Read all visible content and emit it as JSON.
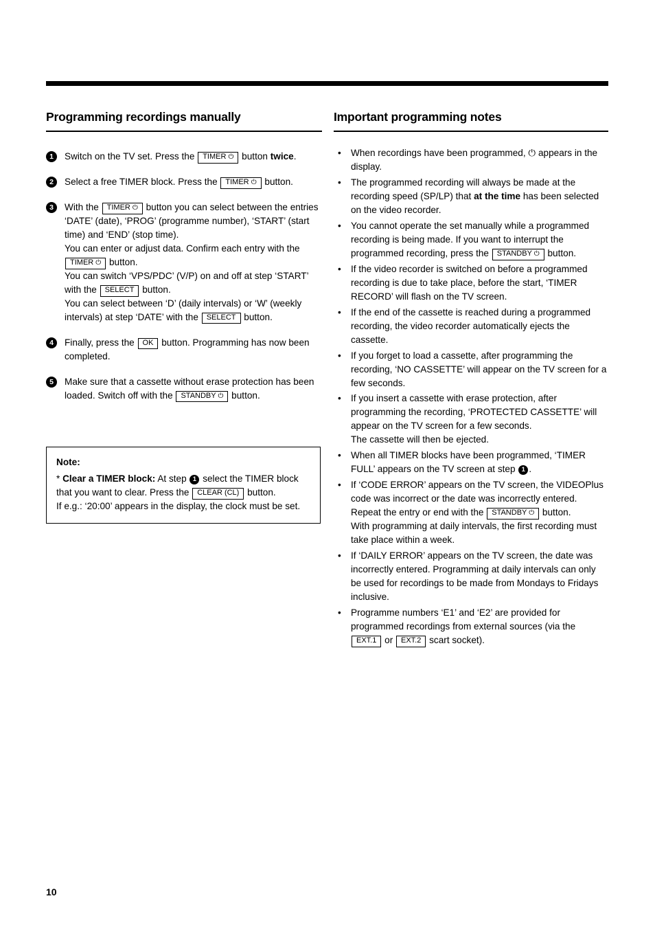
{
  "page_number": "10",
  "left_column": {
    "heading": "Programming recordings manually",
    "steps": [
      {
        "num": "1",
        "parts": [
          {
            "t": "text",
            "v": "Switch on the TV set. Press the "
          },
          {
            "t": "key",
            "v": "TIMER ⏻"
          },
          {
            "t": "text",
            "v": " button "
          },
          {
            "t": "bold",
            "v": "twice"
          },
          {
            "t": "text",
            "v": "."
          }
        ]
      },
      {
        "num": "2",
        "parts": [
          {
            "t": "text",
            "v": "Select a free TIMER block. Press the "
          },
          {
            "t": "key",
            "v": "TIMER ⏻"
          },
          {
            "t": "text",
            "v": " button."
          }
        ]
      },
      {
        "num": "3",
        "parts": [
          {
            "t": "text",
            "v": "With the "
          },
          {
            "t": "key",
            "v": "TIMER ⏻"
          },
          {
            "t": "text",
            "v": " button you can select between the entries ‘DATE’ (date), ‘PROG’ (programme number), ‘START’ (start time) and ‘END’ (stop time)."
          },
          {
            "t": "br"
          },
          {
            "t": "text",
            "v": "You can enter or adjust data. Confirm each entry with the "
          },
          {
            "t": "key",
            "v": "TIMER ⏻"
          },
          {
            "t": "text",
            "v": " button."
          },
          {
            "t": "br"
          },
          {
            "t": "text",
            "v": "You can switch ‘VPS/PDC’ (V/P) on and off at step ‘START’ with the "
          },
          {
            "t": "key",
            "v": "SELECT"
          },
          {
            "t": "text",
            "v": " button."
          },
          {
            "t": "br"
          },
          {
            "t": "text",
            "v": "You can select between ‘D’ (daily intervals) or ‘W’ (weekly intervals) at step ‘DATE’ with the "
          },
          {
            "t": "key",
            "v": "SELECT"
          },
          {
            "t": "text",
            "v": " button."
          }
        ]
      },
      {
        "num": "4",
        "parts": [
          {
            "t": "text",
            "v": "Finally, press the "
          },
          {
            "t": "key",
            "v": "OK"
          },
          {
            "t": "text",
            "v": " button. Programming has now been completed."
          }
        ]
      },
      {
        "num": "5",
        "parts": [
          {
            "t": "text",
            "v": "Make sure that a cassette without erase protection has been loaded. Switch off with the "
          },
          {
            "t": "key",
            "v": "STANDBY ⏻"
          },
          {
            "t": "text",
            "v": " button."
          }
        ]
      }
    ],
    "note": {
      "title": "Note:",
      "parts": [
        {
          "t": "text",
          "v": "* "
        },
        {
          "t": "bold",
          "v": "Clear a TIMER block:"
        },
        {
          "t": "text",
          "v": " At step "
        },
        {
          "t": "circlenum",
          "v": "1"
        },
        {
          "t": "text",
          "v": " select the TIMER block that you want to clear. Press the "
        },
        {
          "t": "key",
          "v": "CLEAR (CL)"
        },
        {
          "t": "text",
          "v": " button."
        },
        {
          "t": "br"
        },
        {
          "t": "text",
          "v": "If e.g.: ‘20:00’ appears in the display, the clock must be set."
        }
      ]
    }
  },
  "right_column": {
    "heading": "Important programming notes",
    "bullets": [
      [
        {
          "t": "text",
          "v": "When recordings have been programmed,  ⏻ appears in the display."
        }
      ],
      [
        {
          "t": "text",
          "v": "The programmed recording will always be made at the recording speed (SP/LP) that "
        },
        {
          "t": "bold",
          "v": "at the time"
        },
        {
          "t": "text",
          "v": " has been selected on the video recorder."
        }
      ],
      [
        {
          "t": "text",
          "v": "You cannot operate the set manually while a programmed recording is being made. If you want to interrupt the programmed recording, press the "
        },
        {
          "t": "key",
          "v": "STANDBY ⏻"
        },
        {
          "t": "text",
          "v": " button."
        }
      ],
      [
        {
          "t": "text",
          "v": "If the video recorder is switched on before a programmed recording is due to take place, before the start, ‘TIMER RECORD’ will flash on the TV screen."
        }
      ],
      [
        {
          "t": "text",
          "v": "If the end of the cassette is reached during a programmed recording, the video recorder automatically ejects the cassette."
        }
      ],
      [
        {
          "t": "text",
          "v": "If you forget to load a cassette, after programming the recording, ‘NO CASSETTE’ will appear on the TV screen for a few seconds."
        }
      ],
      [
        {
          "t": "text",
          "v": "If you insert a cassette with erase protection, after programming the recording, ‘PROTECTED CASSETTE’ will appear on the TV screen for a few seconds."
        },
        {
          "t": "br"
        },
        {
          "t": "text",
          "v": "The cassette will then be ejected."
        }
      ],
      [
        {
          "t": "text",
          "v": "When all TIMER blocks have been programmed, ‘TIMER FULL’ appears on the TV screen at step "
        },
        {
          "t": "circlenum",
          "v": "1"
        },
        {
          "t": "text",
          "v": "."
        }
      ],
      [
        {
          "t": "text",
          "v": "If ‘CODE ERROR’ appears on the TV screen, the VIDEOPlus code was incorrect or the date was incorrectly entered. Repeat the entry or end with the "
        },
        {
          "t": "key",
          "v": "STANDBY ⏻"
        },
        {
          "t": "text",
          "v": " button."
        },
        {
          "t": "br"
        },
        {
          "t": "text",
          "v": "With programming at daily intervals, the first recording must take place within a week."
        }
      ],
      [
        {
          "t": "text",
          "v": "If ‘DAILY ERROR’ appears on the TV screen, the date was incorrectly entered. Programming at daily intervals can only be used for recordings to be made from Mondays to Fridays inclusive."
        }
      ],
      [
        {
          "t": "text",
          "v": "Programme numbers ‘E1’ and ‘E2’ are provided for programmed recordings from external sources (via the "
        },
        {
          "t": "key",
          "v": "EXT.1"
        },
        {
          "t": "text",
          "v": " or "
        },
        {
          "t": "key",
          "v": "EXT.2"
        },
        {
          "t": "text",
          "v": " scart socket)."
        }
      ]
    ]
  }
}
